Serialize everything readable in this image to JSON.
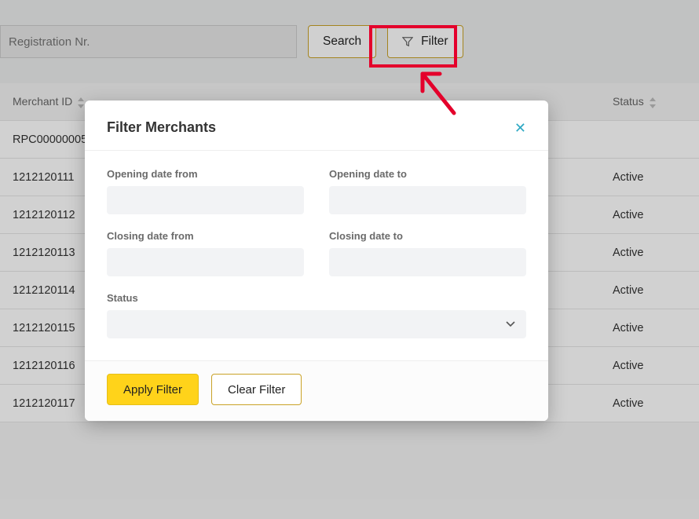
{
  "search": {
    "registration_placeholder": "Registration Nr.",
    "search_button": "Search",
    "filter_button": "Filter"
  },
  "table": {
    "columns": {
      "merchant_id": "Merchant ID",
      "status": "Status"
    },
    "rows": [
      {
        "id": "RPC00000005",
        "status": ""
      },
      {
        "id": "1212120111",
        "status": "Active"
      },
      {
        "id": "1212120112",
        "status": "Active"
      },
      {
        "id": "1212120113",
        "status": "Active"
      },
      {
        "id": "1212120114",
        "status": "Active"
      },
      {
        "id": "1212120115",
        "status": "Active"
      },
      {
        "id": "1212120116",
        "status": "Active"
      },
      {
        "id": "1212120117",
        "status": "Active"
      }
    ]
  },
  "modal": {
    "title": "Filter Merchants",
    "opening_from_label": "Opening date from",
    "opening_to_label": "Opening date to",
    "closing_from_label": "Closing date from",
    "closing_to_label": "Closing date to",
    "status_label": "Status",
    "status_value": "",
    "apply_label": "Apply Filter",
    "clear_label": "Clear Filter"
  }
}
